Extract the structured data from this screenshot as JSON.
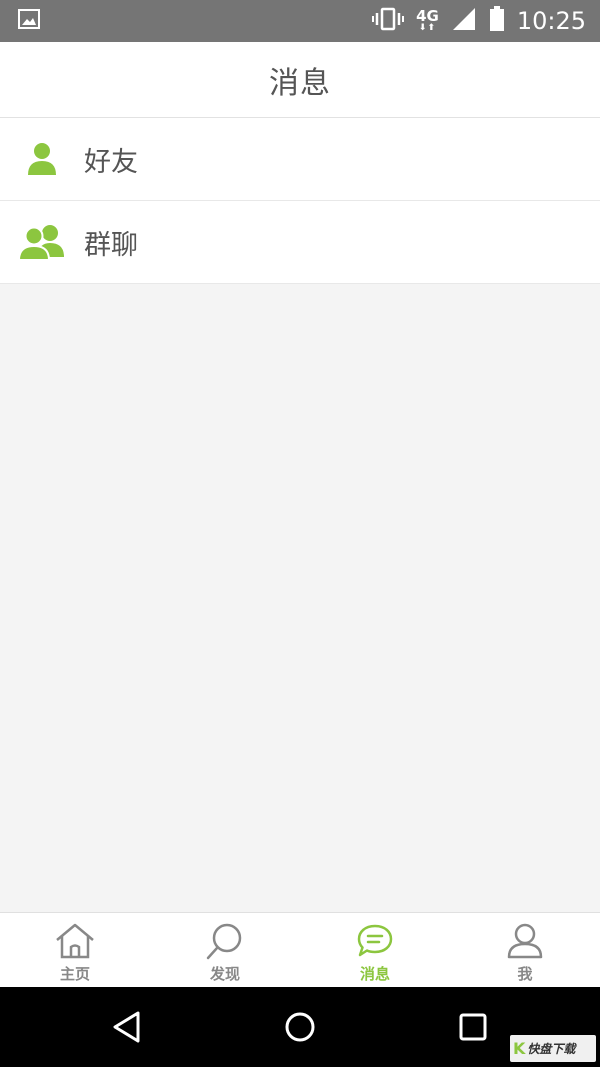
{
  "status_bar": {
    "network": "4G",
    "network_arrows": "⬇⬆",
    "time": "10:25"
  },
  "header": {
    "title": "消息"
  },
  "list": {
    "items": [
      {
        "label": "好友",
        "icon": "person-icon"
      },
      {
        "label": "群聊",
        "icon": "group-icon"
      }
    ]
  },
  "tabs": {
    "items": [
      {
        "label": "主页",
        "icon": "home-icon",
        "active": false
      },
      {
        "label": "发现",
        "icon": "discover-icon",
        "active": false
      },
      {
        "label": "消息",
        "icon": "message-icon",
        "active": true
      },
      {
        "label": "我",
        "icon": "profile-icon",
        "active": false
      }
    ]
  },
  "colors": {
    "accent": "#8cc63f",
    "status_bar": "#757575",
    "nav_bar": "#000000",
    "background": "#f4f4f4"
  },
  "watermark": {
    "k": "K",
    "text": "快盘下载"
  }
}
